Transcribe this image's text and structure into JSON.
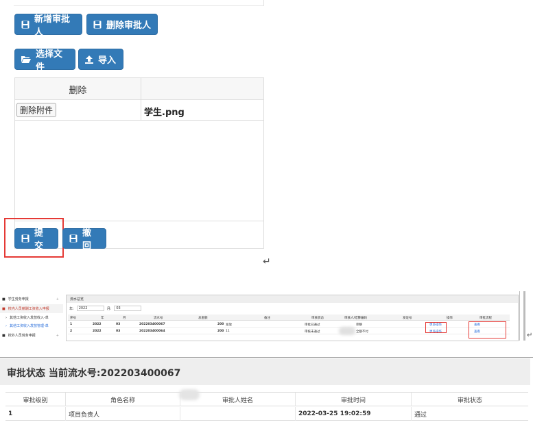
{
  "top": {
    "add_approver": "新增审批人",
    "delete_approver": "删除审批人",
    "choose_file": "选择文件",
    "import": "导入",
    "table_header_delete": "删除",
    "delete_attachment": "删除附件",
    "file_name": "学生.png",
    "submit": "提交",
    "withdraw": "撤回",
    "return_mark": "↵"
  },
  "thumbnail": {
    "sidebar": [
      {
        "label": "学生劳务申报"
      },
      {
        "label": "校内人员薪酬工资收入申报"
      },
      {
        "label": "其他工资收入发放收入-单"
      },
      {
        "label": "其他工资收入发放管理-单"
      },
      {
        "label": "校外人员劳务申报"
      }
    ],
    "frame_title": "流水总览",
    "filter": {
      "year_label": "年:",
      "year": "2022",
      "month_label": "月:",
      "month": "03"
    },
    "columns": [
      "序号",
      "年",
      "月",
      "流水号",
      "总金额",
      "备注",
      "审核状态",
      "审核人/结算编码",
      "发证号",
      "操作",
      "审批流程"
    ],
    "rows": [
      {
        "no": "1",
        "year": "2022",
        "month": "03",
        "serial": "202203400067",
        "amount": "200",
        "remark": "发放",
        "status": "审批已通过",
        "auditor": "完整",
        "op": "更多操作",
        "flow": "查看"
      },
      {
        "no": "2",
        "year": "2022",
        "month": "03",
        "serial": "202203400064",
        "amount": "200",
        "remark": "11",
        "status": "审核未通过",
        "auditor": "全额不付",
        "op": "更多操作",
        "flow": "查看"
      }
    ]
  },
  "approval": {
    "title": "审批状态 当前流水号:202203400067",
    "columns": [
      "审批级别",
      "角色名称",
      "审批人姓名",
      "审批时间",
      "审批状态"
    ],
    "rows": [
      {
        "level": "1",
        "role": "项目负责人",
        "name": "",
        "time": "2022-03-25 19:02:59",
        "status": "通过"
      }
    ]
  },
  "colors": {
    "primary": "#337ab7",
    "highlight": "#e53935"
  }
}
